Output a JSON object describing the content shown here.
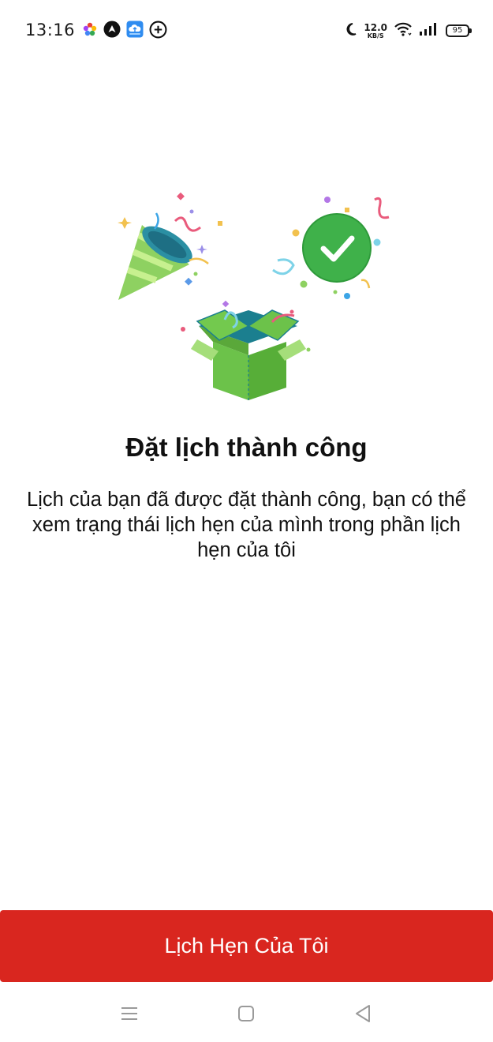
{
  "status_bar": {
    "time": "13:16",
    "net_speed_value": "12.0",
    "net_speed_unit": "KB/S",
    "battery_level": "95",
    "icons_left": [
      "flower-app-icon",
      "nav-app-icon",
      "cloud-app-icon",
      "add-circle-icon"
    ],
    "icons_right": [
      "moon-icon",
      "wifi-icon",
      "signal-icon",
      "battery-icon"
    ]
  },
  "illustration": {
    "name": "booking-success-illustration",
    "elements": [
      "party-popper-icon",
      "check-circle-icon",
      "gift-box-icon",
      "confetti"
    ]
  },
  "content": {
    "title": "Đặt lịch thành công",
    "description": "Lịch của bạn đã được đặt thành công, bạn có thể xem trạng thái lịch hẹn của mình trong phần lịch hẹn của tôi"
  },
  "actions": {
    "my_appointments_label": "Lịch Hẹn Của Tôi"
  },
  "nav_bar": {
    "items": [
      "menu-icon",
      "home-icon",
      "back-icon"
    ]
  },
  "colors": {
    "primary_button": "#d9261f",
    "success_green": "#3fb14a",
    "box_green": "#6cc24a",
    "party_green": "#8ed161"
  }
}
